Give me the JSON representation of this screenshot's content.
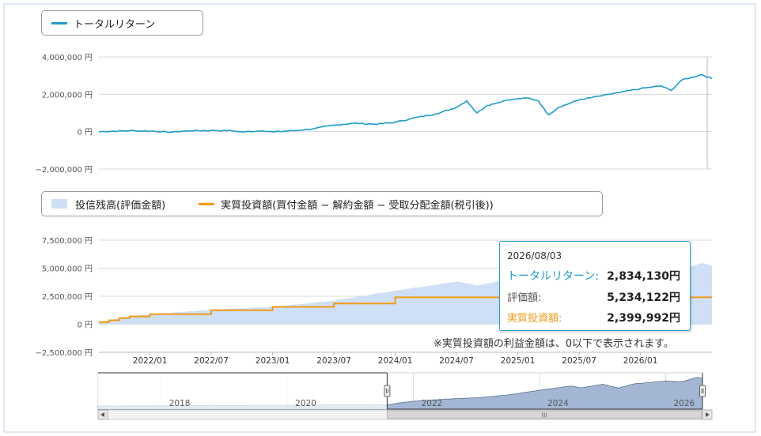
{
  "colors": {
    "total_return": "#1a9ccc",
    "valuation_fill": "#cfdff5",
    "net_investment": "#f39a19",
    "navigator_fill": "#a3b7d5",
    "navigator_line": "#5d7295",
    "tooltip_border": "#22a1c8"
  },
  "legend_top": {
    "items": [
      {
        "label": "トータルリターン",
        "icon": "line-swatch",
        "color": "#1a9ccc"
      }
    ]
  },
  "legend_bottom": {
    "items": [
      {
        "label": "投信残高(評価金額)",
        "icon": "area-swatch",
        "color": "#cfdff5"
      },
      {
        "label": "実質投資額(買付金額 − 解約金額 − 受取分配金額(税引後))",
        "icon": "line-swatch",
        "color": "#f39a19"
      }
    ]
  },
  "tooltip": {
    "date": "2026/08/03",
    "rows": [
      {
        "label": "トータルリターン:",
        "value": "2,834,130円",
        "label_color": "#1a9ccc"
      },
      {
        "label": "評価額:",
        "value": "5,234,122円",
        "label_color": "#555555"
      },
      {
        "label": "実質投資額:",
        "value": "2,399,992円",
        "label_color": "#f39a19"
      }
    ]
  },
  "note": "※実質投資額の利益金額は、0以下で表示されます。",
  "navigator": {
    "year_labels": [
      "2018",
      "2020",
      "2022",
      "2024",
      "2026"
    ],
    "selected_range": [
      "2021/08",
      "2026/08"
    ],
    "scrollbar_grip": "III"
  },
  "chart_data": [
    {
      "type": "line",
      "series": [
        {
          "name": "トータルリターン"
        }
      ],
      "x_range": [
        "2021/08",
        "2026/08"
      ],
      "y_ticks": [
        "4,000,000 円",
        "2,000,000 円",
        "0 円",
        "−2,000,000 円"
      ],
      "ylim": [
        -2000000,
        4000000
      ],
      "points": [
        [
          "2021/08",
          0
        ],
        [
          "2021/11",
          50000
        ],
        [
          "2022/01",
          30000
        ],
        [
          "2022/03",
          -30000
        ],
        [
          "2022/05",
          50000
        ],
        [
          "2022/07",
          60000
        ],
        [
          "2022/09",
          50000
        ],
        [
          "2022/10",
          -20000
        ],
        [
          "2022/12",
          50000
        ],
        [
          "2023/01",
          -20000
        ],
        [
          "2023/03",
          50000
        ],
        [
          "2023/05",
          150000
        ],
        [
          "2023/07",
          350000
        ],
        [
          "2023/09",
          450000
        ],
        [
          "2023/11",
          400000
        ],
        [
          "2024/01",
          500000
        ],
        [
          "2024/03",
          750000
        ],
        [
          "2024/05",
          950000
        ],
        [
          "2024/07",
          1300000
        ],
        [
          "2024/08",
          1650000
        ],
        [
          "2024/09",
          1000000
        ],
        [
          "2024/10",
          1400000
        ],
        [
          "2024/12",
          1700000
        ],
        [
          "2025/02",
          1800000
        ],
        [
          "2025/03",
          1650000
        ],
        [
          "2025/04",
          900000
        ],
        [
          "2025/05",
          1300000
        ],
        [
          "2025/07",
          1700000
        ],
        [
          "2025/09",
          1900000
        ],
        [
          "2025/11",
          2100000
        ],
        [
          "2026/01",
          2300000
        ],
        [
          "2026/03",
          2450000
        ],
        [
          "2026/04",
          2200000
        ],
        [
          "2026/05",
          2750000
        ],
        [
          "2026/07",
          3050000
        ],
        [
          "2026/08",
          2834130
        ]
      ]
    },
    {
      "type": "area",
      "x_ticks": [
        "2022/01",
        "2022/07",
        "2023/01",
        "2023/07",
        "2024/01",
        "2024/07",
        "2025/01",
        "2025/07",
        "2026/01"
      ],
      "y_ticks": [
        "7,500,000 円",
        "5,000,000 円",
        "2,500,000 円",
        "0 円",
        "−2,500,000 円"
      ],
      "ylim": [
        -2500000,
        7500000
      ],
      "series": [
        {
          "name": "投信残高(評価金額)",
          "points": [
            [
              "2021/08",
              200000
            ],
            [
              "2021/11",
              700000
            ],
            [
              "2022/01",
              900000
            ],
            [
              "2022/07",
              1300000
            ],
            [
              "2023/01",
              1550000
            ],
            [
              "2023/07",
              2100000
            ],
            [
              "2024/01",
              3000000
            ],
            [
              "2024/07",
              3800000
            ],
            [
              "2024/09",
              3450000
            ],
            [
              "2025/01",
              4150000
            ],
            [
              "2025/04",
              3400000
            ],
            [
              "2025/07",
              4200000
            ],
            [
              "2026/01",
              4750000
            ],
            [
              "2026/04",
              4600000
            ],
            [
              "2026/07",
              5450000
            ],
            [
              "2026/08",
              5234122
            ]
          ]
        },
        {
          "name": "実質投資額(買付金額 − 解約金額 − 受取分配金額(税引後))",
          "points": [
            [
              "2021/08",
              200000
            ],
            [
              "2021/09",
              350000
            ],
            [
              "2021/10",
              550000
            ],
            [
              "2021/11",
              700000
            ],
            [
              "2022/01",
              900000
            ],
            [
              "2022/07",
              1250000
            ],
            [
              "2023/01",
              1550000
            ],
            [
              "2023/07",
              1850000
            ],
            [
              "2024/01",
              2399992
            ],
            [
              "2026/08",
              2399992
            ]
          ]
        }
      ]
    }
  ]
}
